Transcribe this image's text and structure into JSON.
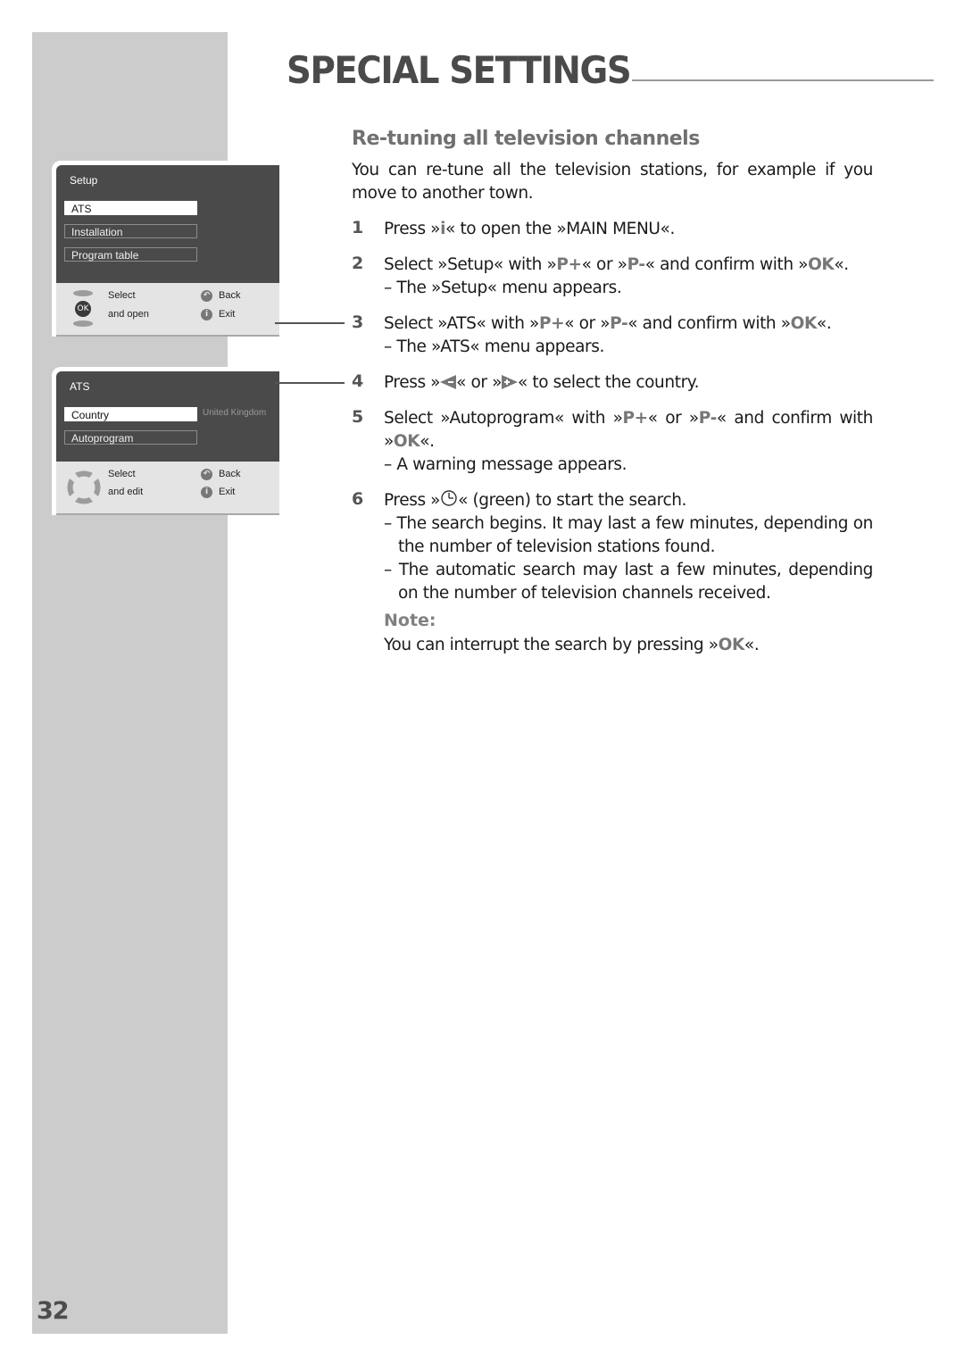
{
  "page": {
    "title": "SPECIAL SETTINGS",
    "page_number": "32"
  },
  "section": {
    "heading": "Re-tuning all television channels",
    "intro": "You can re-tune all the television stations, for example if you move to another town."
  },
  "steps": [
    {
      "num": "1",
      "pre": "Press »",
      "key": "i",
      "post": "« to open the »MAIN MENU«."
    },
    {
      "num": "2",
      "parts": [
        "Select »Setup« with »",
        "P+",
        "« or »",
        "P-",
        "« and confirm with »",
        "OK",
        "«."
      ],
      "sub": [
        "– The »Setup« menu appears."
      ]
    },
    {
      "num": "3",
      "parts": [
        "Select »ATS« with »",
        "P+",
        "« or »",
        "P-",
        "« and confirm with »",
        "OK",
        "«."
      ],
      "sub": [
        "– The »ATS« menu appears."
      ]
    },
    {
      "num": "4",
      "pre": "Press »",
      "mid": "« or »",
      "post": "« to select the country.",
      "icons": [
        "left-arrow-minus-icon",
        "right-arrow-plus-icon"
      ]
    },
    {
      "num": "5",
      "parts": [
        "Select »Autoprogram« with »",
        "P+",
        "« or »",
        "P-",
        "« and confirm with »",
        "OK",
        "«."
      ],
      "sub": [
        "– A warning message appears."
      ]
    },
    {
      "num": "6",
      "pre": "Press »",
      "post": "« (green) to start the search.",
      "icon": "clock-icon",
      "sub": [
        "– The search begins. It may last a few minutes, depending on the number of television stations found.",
        "– The automatic search may last a few minutes, depending on the number of television channels received."
      ]
    }
  ],
  "note": {
    "label": "Note:",
    "pre": "You can interrupt the search by pressing »",
    "key": "OK",
    "post": "«."
  },
  "osd_setup": {
    "title": "Setup",
    "items": [
      "ATS",
      "Installation",
      "Program table"
    ],
    "selected_index": 0,
    "footer": {
      "select": "Select",
      "action": "and open",
      "back": "Back",
      "exit": "Exit",
      "ok_label": "OK"
    }
  },
  "osd_ats": {
    "title": "ATS",
    "items": [
      "Country",
      "Autoprogram"
    ],
    "selected_index": 0,
    "country_value": "United Kingdom",
    "footer": {
      "select": "Select",
      "action": "and edit",
      "back": "Back",
      "exit": "Exit"
    }
  }
}
